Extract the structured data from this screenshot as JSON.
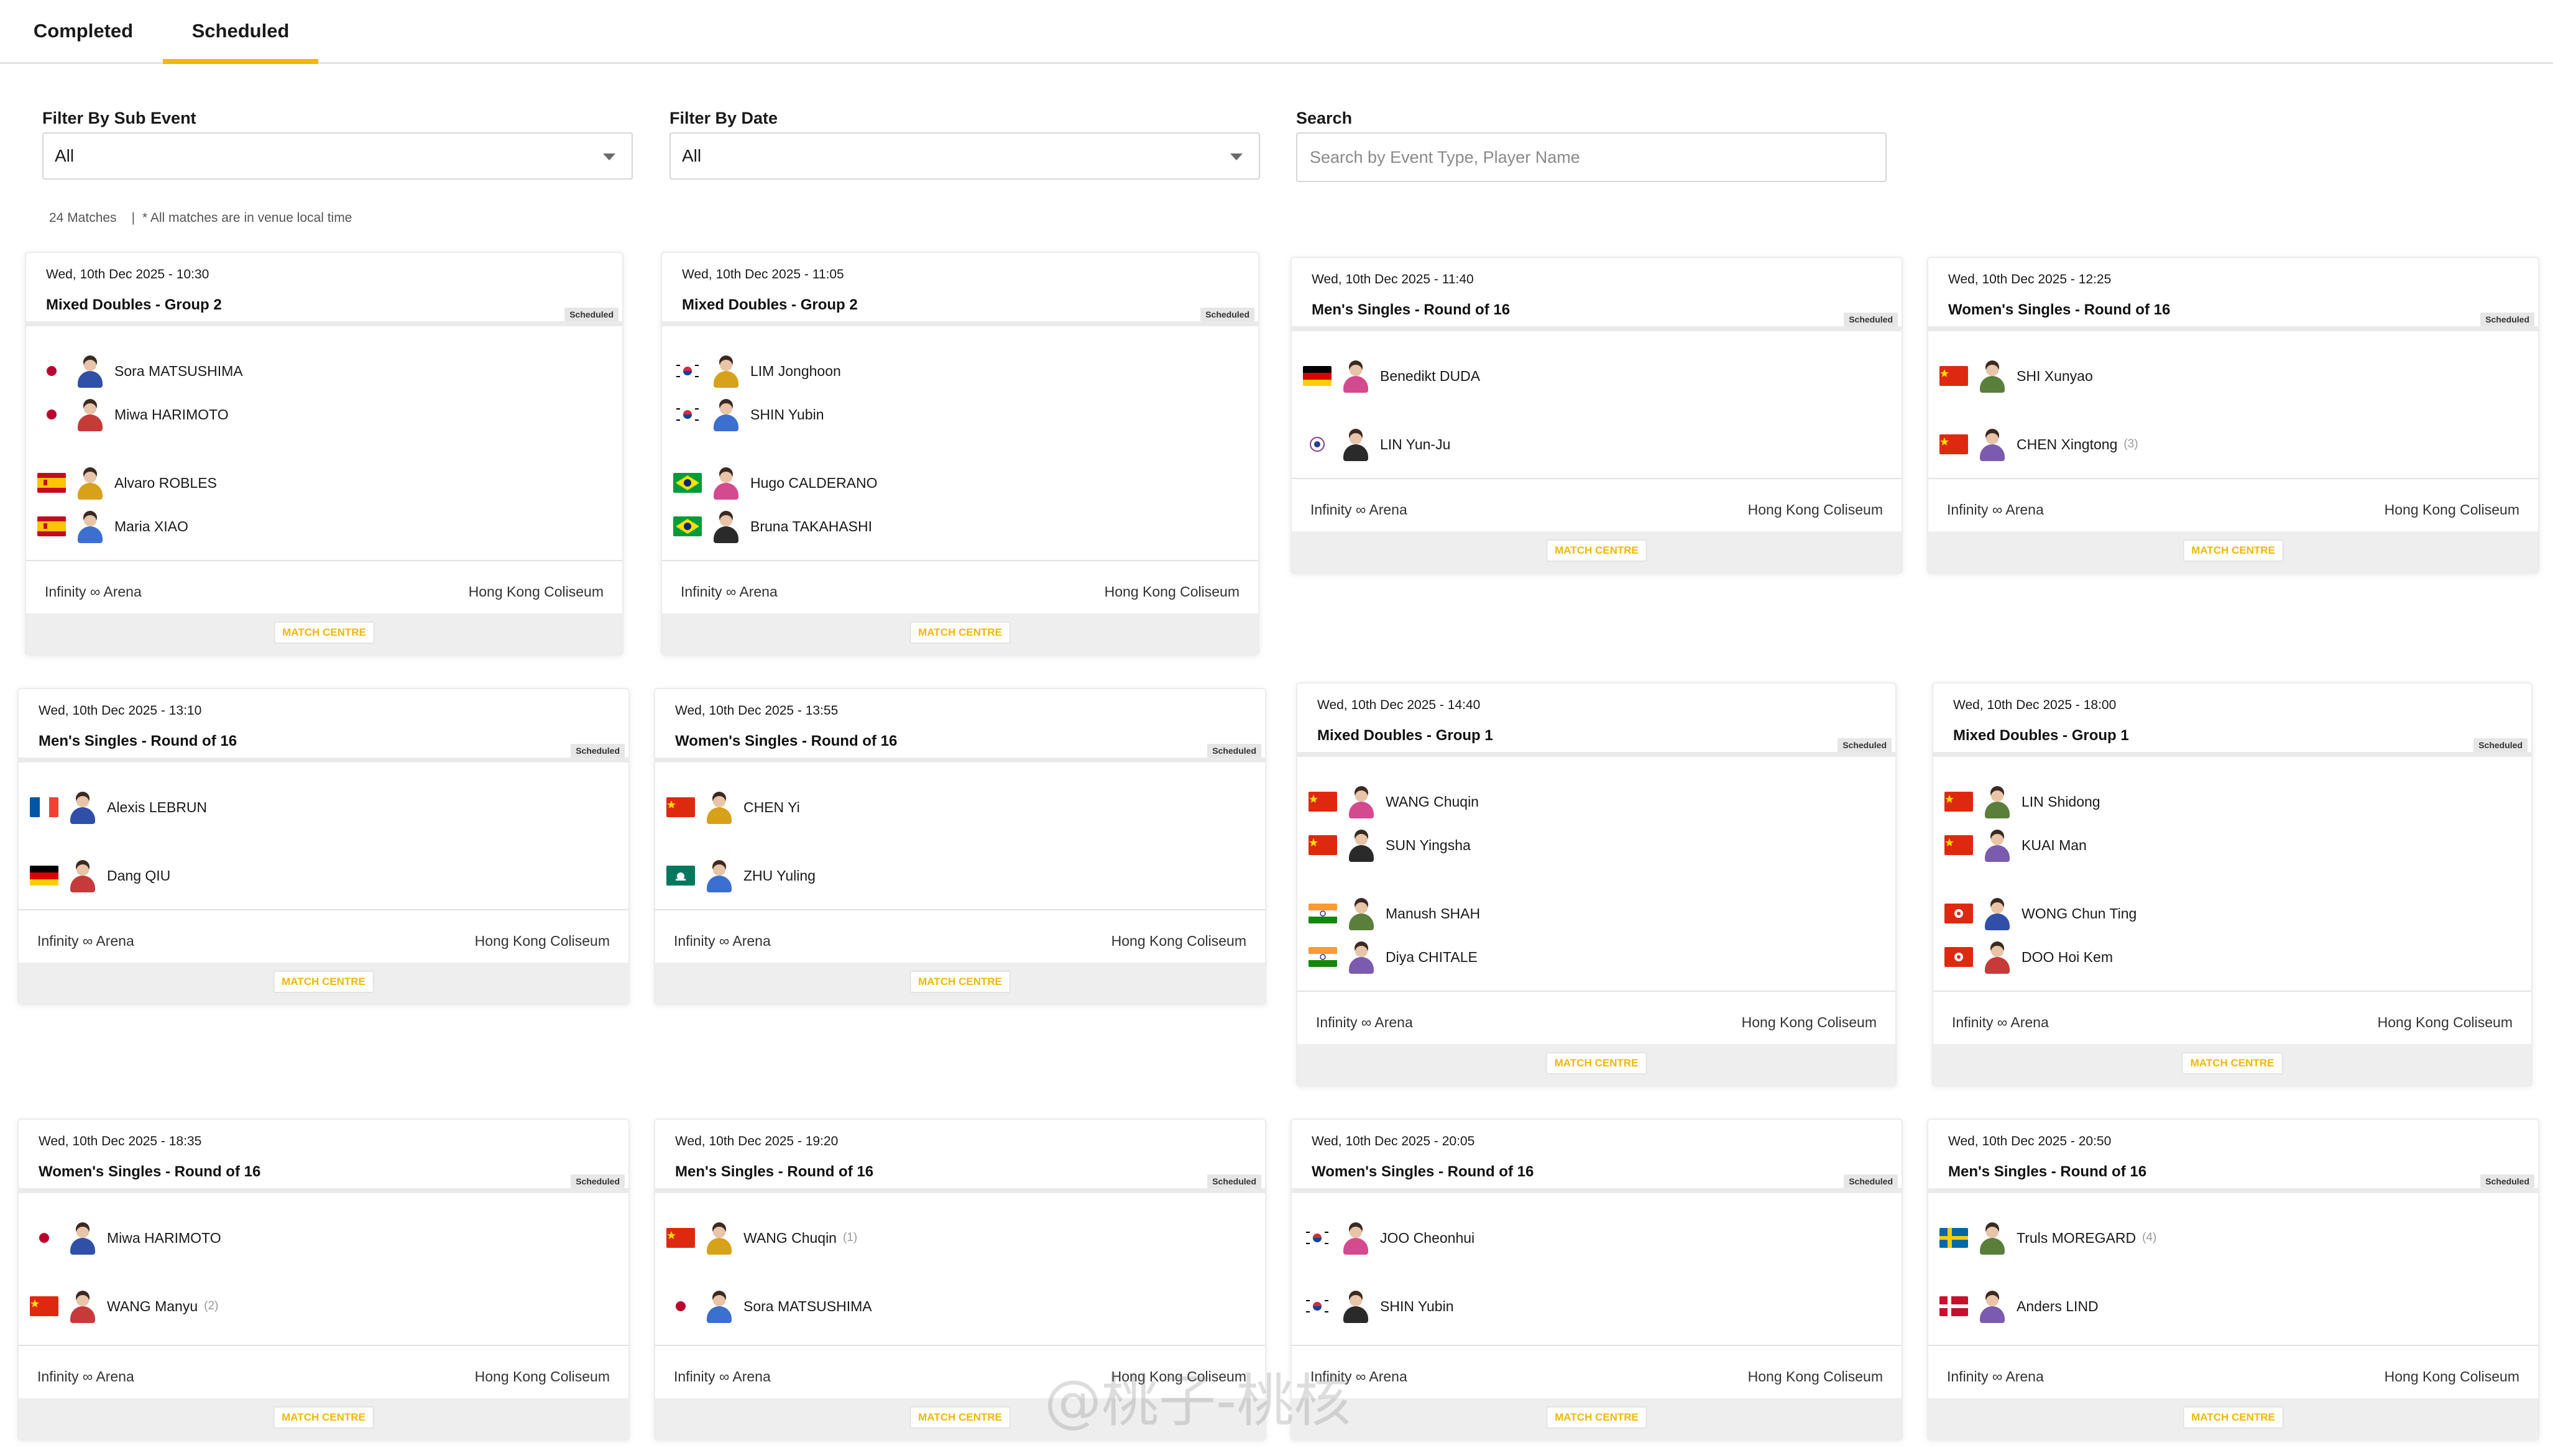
{
  "tabs": [
    {
      "label": "Completed",
      "active": false
    },
    {
      "label": "Scheduled",
      "active": true
    }
  ],
  "filters": {
    "sub_event_label": "Filter By Sub Event",
    "sub_event_value": "All",
    "date_label": "Filter By Date",
    "date_value": "All",
    "search_label": "Search",
    "search_placeholder": "Search by Event Type, Player Name"
  },
  "meta": {
    "count": "24 Matches",
    "separator": "|",
    "note": "* All matches are in venue local time"
  },
  "common": {
    "status": "Scheduled",
    "venue_left": "Infinity ∞ Arena",
    "venue_right": "Hong Kong Coliseum",
    "match_centre": "MATCH CENTRE"
  },
  "colors": {
    "accent": "#f2b705"
  },
  "matches": [
    {
      "date": "Wed, 10th Dec 2025 - 10:30",
      "event": "Mixed Doubles - Group 2",
      "players": [
        {
          "name": "Sora MATSUSHIMA",
          "seed": "",
          "flag": "jp"
        },
        {
          "name": "Miwa HARIMOTO",
          "seed": "",
          "flag": "jp"
        },
        {
          "name": "Alvaro ROBLES",
          "seed": "",
          "flag": "es"
        },
        {
          "name": "Maria XIAO",
          "seed": "",
          "flag": "es"
        }
      ]
    },
    {
      "date": "Wed, 10th Dec 2025 - 11:05",
      "event": "Mixed Doubles - Group 2",
      "players": [
        {
          "name": "LIM Jonghoon",
          "seed": "",
          "flag": "kr"
        },
        {
          "name": "SHIN Yubin",
          "seed": "",
          "flag": "kr"
        },
        {
          "name": "Hugo CALDERANO",
          "seed": "",
          "flag": "br"
        },
        {
          "name": "Bruna TAKAHASHI",
          "seed": "",
          "flag": "br"
        }
      ]
    },
    {
      "date": "Wed, 10th Dec 2025 - 11:40",
      "event": "Men's Singles - Round of 16",
      "players": [
        {
          "name": "Benedikt DUDA",
          "seed": "",
          "flag": "de"
        },
        {
          "name": "LIN Yun-Ju",
          "seed": "",
          "flag": "tpe"
        }
      ]
    },
    {
      "date": "Wed, 10th Dec 2025 - 12:25",
      "event": "Women's Singles - Round of 16",
      "players": [
        {
          "name": "SHI Xunyao",
          "seed": "",
          "flag": "cn"
        },
        {
          "name": "CHEN Xingtong",
          "seed": "(3)",
          "flag": "cn"
        }
      ]
    },
    {
      "date": "Wed, 10th Dec 2025 - 13:10",
      "event": "Men's Singles - Round of 16",
      "players": [
        {
          "name": "Alexis LEBRUN",
          "seed": "",
          "flag": "fr"
        },
        {
          "name": "Dang QIU",
          "seed": "",
          "flag": "de"
        }
      ]
    },
    {
      "date": "Wed, 10th Dec 2025 - 13:55",
      "event": "Women's Singles - Round of 16",
      "players": [
        {
          "name": "CHEN Yi",
          "seed": "",
          "flag": "cn"
        },
        {
          "name": "ZHU Yuling",
          "seed": "",
          "flag": "mo"
        }
      ]
    },
    {
      "date": "Wed, 10th Dec 2025 - 14:40",
      "event": "Mixed Doubles - Group 1",
      "players": [
        {
          "name": "WANG Chuqin",
          "seed": "",
          "flag": "cn"
        },
        {
          "name": "SUN Yingsha",
          "seed": "",
          "flag": "cn"
        },
        {
          "name": "Manush SHAH",
          "seed": "",
          "flag": "in"
        },
        {
          "name": "Diya CHITALE",
          "seed": "",
          "flag": "in"
        }
      ]
    },
    {
      "date": "Wed, 10th Dec 2025 - 18:00",
      "event": "Mixed Doubles - Group 1",
      "players": [
        {
          "name": "LIN Shidong",
          "seed": "",
          "flag": "cn"
        },
        {
          "name": "KUAI Man",
          "seed": "",
          "flag": "cn"
        },
        {
          "name": "WONG Chun Ting",
          "seed": "",
          "flag": "hk"
        },
        {
          "name": "DOO Hoi Kem",
          "seed": "",
          "flag": "hk"
        }
      ]
    },
    {
      "date": "Wed, 10th Dec 2025 - 18:35",
      "event": "Women's Singles - Round of 16",
      "players": [
        {
          "name": "Miwa HARIMOTO",
          "seed": "",
          "flag": "jp"
        },
        {
          "name": "WANG Manyu",
          "seed": "(2)",
          "flag": "cn"
        }
      ]
    },
    {
      "date": "Wed, 10th Dec 2025 - 19:20",
      "event": "Men's Singles - Round of 16",
      "players": [
        {
          "name": "WANG Chuqin",
          "seed": "(1)",
          "flag": "cn"
        },
        {
          "name": "Sora MATSUSHIMA",
          "seed": "",
          "flag": "jp"
        }
      ]
    },
    {
      "date": "Wed, 10th Dec 2025 - 20:05",
      "event": "Women's Singles - Round of 16",
      "players": [
        {
          "name": "JOO Cheonhui",
          "seed": "",
          "flag": "kr"
        },
        {
          "name": "SHIN Yubin",
          "seed": "",
          "flag": "kr"
        }
      ]
    },
    {
      "date": "Wed, 10th Dec 2025 - 20:50",
      "event": "Men's Singles - Round of 16",
      "players": [
        {
          "name": "Truls MOREGARD",
          "seed": "(4)",
          "flag": "se"
        },
        {
          "name": "Anders LIND",
          "seed": "",
          "flag": "dk"
        }
      ]
    }
  ],
  "watermark": "@桃子-桃核"
}
